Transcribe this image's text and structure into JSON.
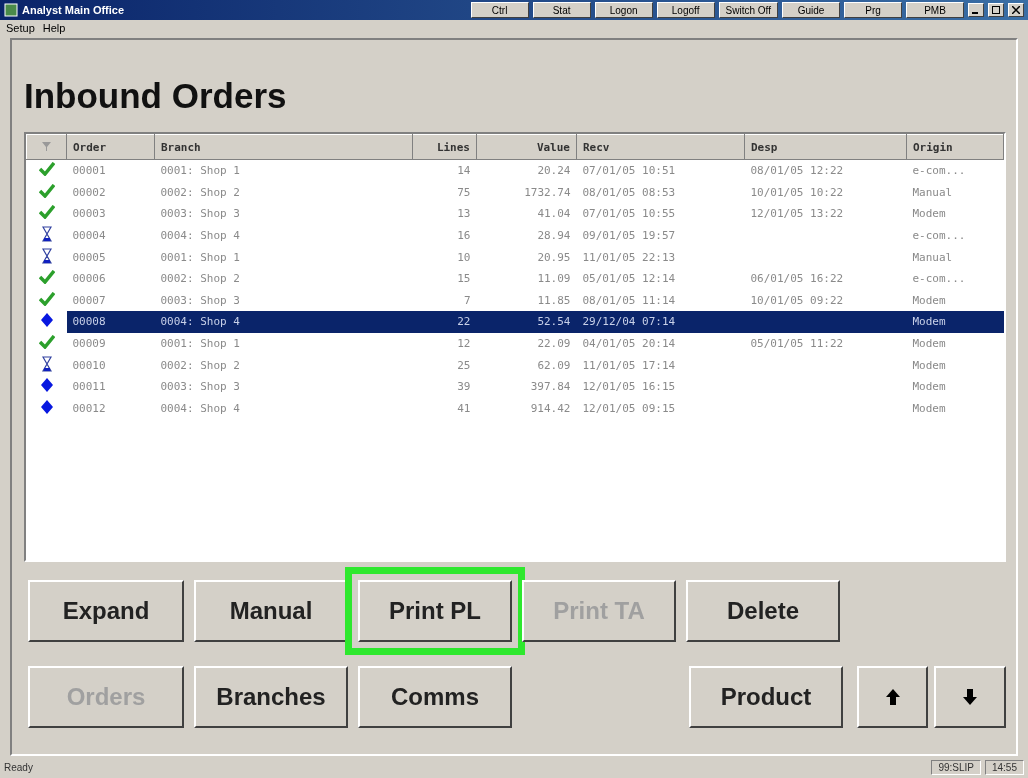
{
  "window": {
    "title": "Analyst Main Office",
    "title_buttons": [
      "Ctrl",
      "Stat",
      "Logon",
      "Logoff",
      "Switch Off",
      "Guide",
      "Prg",
      "PMB"
    ]
  },
  "menu": [
    "Setup",
    "Help"
  ],
  "heading": "Inbound Orders",
  "table": {
    "columns": [
      "Order",
      "Branch",
      "Lines",
      "Value",
      "Recv",
      "Desp",
      "Origin"
    ],
    "rows": [
      {
        "kind": "done",
        "selected": false,
        "cells": [
          "00001",
          "0001: Shop 1",
          "14",
          "20.24",
          "07/01/05 10:51",
          "08/01/05 12:22",
          "e-com..."
        ]
      },
      {
        "kind": "done",
        "selected": false,
        "cells": [
          "00002",
          "0002: Shop 2",
          "75",
          "1732.74",
          "08/01/05 08:53",
          "10/01/05 10:22",
          "Manual"
        ]
      },
      {
        "kind": "done",
        "selected": false,
        "cells": [
          "00003",
          "0003: Shop 3",
          "13",
          "41.04",
          "07/01/05 10:55",
          "12/01/05 13:22",
          "Modem"
        ]
      },
      {
        "kind": "pending",
        "selected": false,
        "cells": [
          "00004",
          "0004: Shop 4",
          "16",
          "28.94",
          "09/01/05 19:57",
          "",
          "e-com..."
        ]
      },
      {
        "kind": "pending",
        "selected": false,
        "cells": [
          "00005",
          "0001: Shop 1",
          "10",
          "20.95",
          "11/01/05 22:13",
          "",
          "Manual"
        ]
      },
      {
        "kind": "done",
        "selected": false,
        "cells": [
          "00006",
          "0002: Shop 2",
          "15",
          "11.09",
          "05/01/05 12:14",
          "06/01/05 16:22",
          "e-com..."
        ]
      },
      {
        "kind": "done",
        "selected": false,
        "cells": [
          "00007",
          "0003: Shop 3",
          "7",
          "11.85",
          "08/01/05 11:14",
          "10/01/05 09:22",
          "Modem"
        ]
      },
      {
        "kind": "new",
        "selected": true,
        "cells": [
          "00008",
          "0004: Shop 4",
          "22",
          "52.54",
          "29/12/04 07:14",
          "",
          "Modem"
        ]
      },
      {
        "kind": "done",
        "selected": false,
        "cells": [
          "00009",
          "0001: Shop 1",
          "12",
          "22.09",
          "04/01/05 20:14",
          "05/01/05 11:22",
          "Modem"
        ]
      },
      {
        "kind": "pending",
        "selected": false,
        "cells": [
          "00010",
          "0002: Shop 2",
          "25",
          "62.09",
          "11/01/05 17:14",
          "",
          "Modem"
        ]
      },
      {
        "kind": "new",
        "selected": false,
        "cells": [
          "00011",
          "0003: Shop 3",
          "39",
          "397.84",
          "12/01/05 16:15",
          "",
          "Modem"
        ]
      },
      {
        "kind": "new",
        "selected": false,
        "cells": [
          "00012",
          "0004: Shop 4",
          "41",
          "914.42",
          "12/01/05 09:15",
          "",
          "Modem"
        ]
      }
    ]
  },
  "button_rows": [
    [
      {
        "kind": "text",
        "label": "Expand",
        "disabled": false,
        "highlighted": false
      },
      {
        "kind": "text",
        "label": "Manual",
        "disabled": false,
        "highlighted": false
      },
      {
        "kind": "text",
        "label": "Print PL",
        "disabled": false,
        "highlighted": true
      },
      {
        "kind": "text",
        "label": "Print TA",
        "disabled": true,
        "highlighted": false
      },
      {
        "kind": "text",
        "label": "Delete",
        "disabled": false,
        "highlighted": false
      }
    ],
    [
      {
        "kind": "text",
        "label": "Orders",
        "disabled": true,
        "highlighted": false
      },
      {
        "kind": "text",
        "label": "Branches",
        "disabled": false,
        "highlighted": false
      },
      {
        "kind": "text",
        "label": "Comms",
        "disabled": false,
        "highlighted": false
      },
      {
        "kind": "spacer"
      },
      {
        "kind": "text",
        "label": "Product",
        "disabled": false,
        "highlighted": false
      },
      {
        "kind": "up"
      },
      {
        "kind": "down"
      }
    ]
  ],
  "status_bar": {
    "text": "Ready",
    "panels": [
      "99:SLIP",
      "14:55"
    ]
  }
}
